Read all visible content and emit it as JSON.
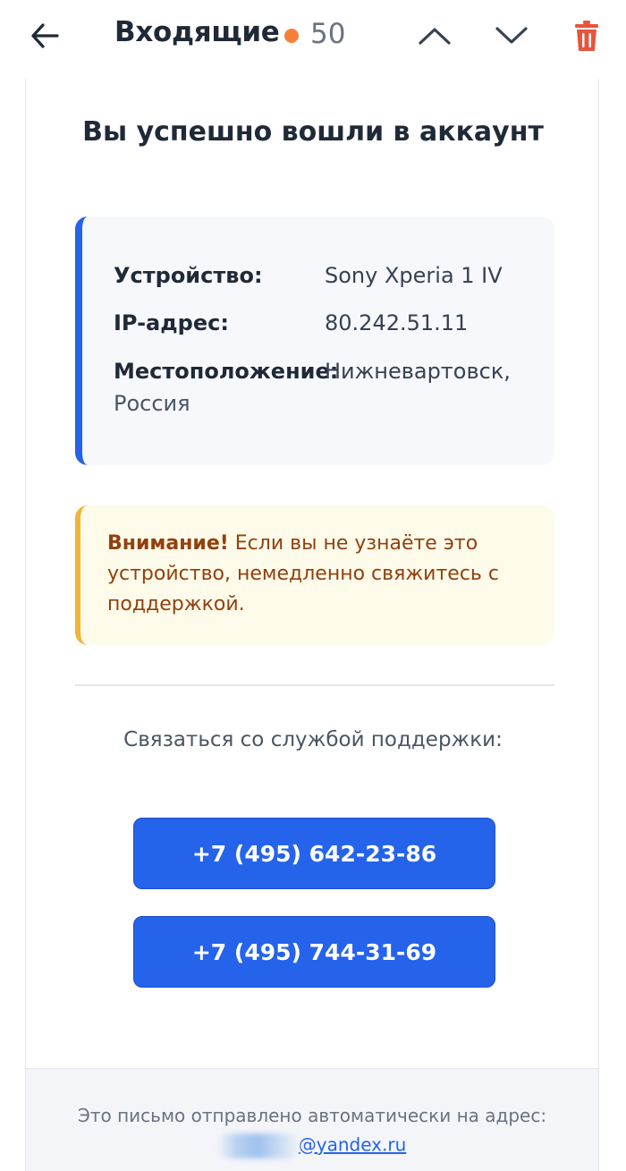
{
  "header": {
    "folder_title": "Входящие",
    "unread_count": "50",
    "unread_dot_color": "#f5803e",
    "icons": [
      "arrow-left-icon",
      "chevron-up-icon",
      "chevron-down-icon",
      "trash-icon"
    ]
  },
  "email": {
    "heading": "Вы успешно вошли в аккаунт",
    "info": {
      "device_label": "Устройство:",
      "device_value": "Sony Xperia 1 IV",
      "ip_label": "IP-адрес:",
      "ip_value": "80.242.51.11",
      "location_label": "Местоположение:",
      "location_value": "Нижневартовск,",
      "location_value_cont": "Россия",
      "accent_color": "#2563eb"
    },
    "warning": {
      "strong": "Внимание!",
      "text": " Если вы не узнаёте это устройство, немедленно свяжитесь с поддержкой.",
      "accent_color": "#f2b53a"
    },
    "support_label": "Связаться со службой поддержки:",
    "phones": [
      "+7 (495) 642-23-86",
      "+7 (495) 744-31-69"
    ],
    "footer": {
      "text": "Это письмо отправлено автоматически на адрес:",
      "email_domain": "@yandex.ru"
    }
  }
}
